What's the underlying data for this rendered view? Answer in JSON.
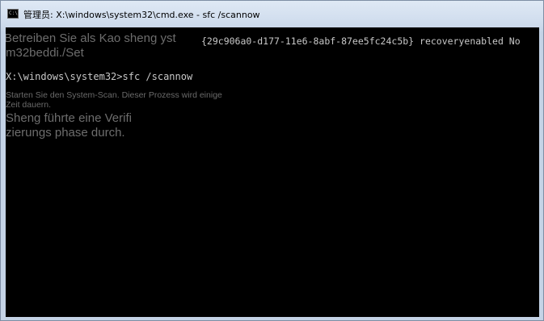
{
  "window": {
    "title": "管理员: X:\\windows\\system32\\cmd.exe - sfc  /scannow",
    "icon": "cmd-icon"
  },
  "console": {
    "overlay_line1": "Betreiben Sie als Kao sheng yst",
    "overlay_line2": "m32beddi./Set",
    "guid_line": "{29c906a0-d177-11e6-8abf-87ee5fc24c5b} recoveryenabled No",
    "prompt_line": "X:\\windows\\system32>sfc /scannow",
    "scan_line1": "Starten Sie den System-Scan. Dieser Prozess wird einige",
    "scan_line2": "Zeit dauern.",
    "verify_line1": "Sheng führte eine Verifi",
    "verify_line2": "zierungs phase durch."
  }
}
